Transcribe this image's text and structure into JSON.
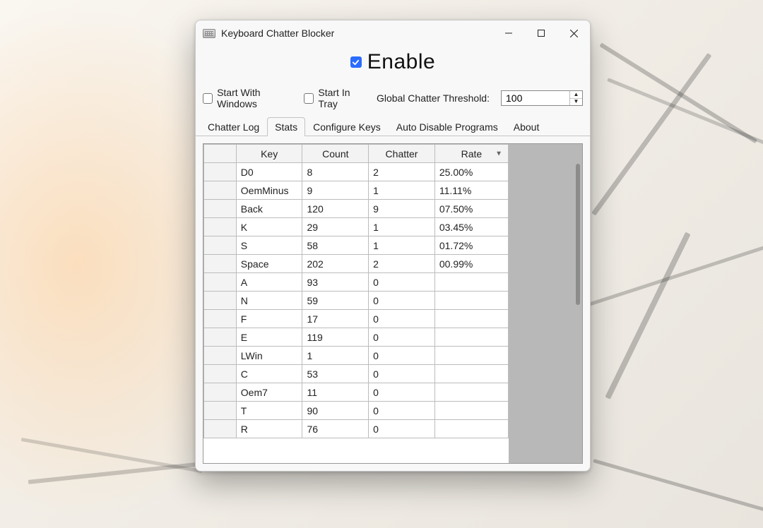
{
  "window": {
    "title": "Keyboard Chatter Blocker"
  },
  "enable": {
    "checked": true,
    "label": "Enable"
  },
  "options": {
    "start_with_windows_label": "Start With Windows",
    "start_with_windows_checked": false,
    "start_in_tray_label": "Start In Tray",
    "start_in_tray_checked": false,
    "global_threshold_label": "Global Chatter Threshold:",
    "global_threshold_value": "100"
  },
  "tabs": {
    "items": [
      {
        "label": "Chatter Log"
      },
      {
        "label": "Stats"
      },
      {
        "label": "Configure Keys"
      },
      {
        "label": "Auto Disable Programs"
      },
      {
        "label": "About"
      }
    ],
    "active_index": 1
  },
  "stats": {
    "columns": {
      "key": "Key",
      "count": "Count",
      "chatter": "Chatter",
      "rate": "Rate"
    },
    "sort_column": "rate",
    "rows": [
      {
        "key": "D0",
        "count": "8",
        "chatter": "2",
        "rate": "25.00%"
      },
      {
        "key": "OemMinus",
        "count": "9",
        "chatter": "1",
        "rate": "11.11%"
      },
      {
        "key": "Back",
        "count": "120",
        "chatter": "9",
        "rate": "07.50%"
      },
      {
        "key": "K",
        "count": "29",
        "chatter": "1",
        "rate": "03.45%"
      },
      {
        "key": "S",
        "count": "58",
        "chatter": "1",
        "rate": "01.72%"
      },
      {
        "key": "Space",
        "count": "202",
        "chatter": "2",
        "rate": "00.99%"
      },
      {
        "key": "A",
        "count": "93",
        "chatter": "0",
        "rate": ""
      },
      {
        "key": "N",
        "count": "59",
        "chatter": "0",
        "rate": ""
      },
      {
        "key": "F",
        "count": "17",
        "chatter": "0",
        "rate": ""
      },
      {
        "key": "E",
        "count": "119",
        "chatter": "0",
        "rate": ""
      },
      {
        "key": "LWin",
        "count": "1",
        "chatter": "0",
        "rate": ""
      },
      {
        "key": "C",
        "count": "53",
        "chatter": "0",
        "rate": ""
      },
      {
        "key": "Oem7",
        "count": "11",
        "chatter": "0",
        "rate": ""
      },
      {
        "key": "T",
        "count": "90",
        "chatter": "0",
        "rate": ""
      },
      {
        "key": "R",
        "count": "76",
        "chatter": "0",
        "rate": ""
      }
    ]
  }
}
